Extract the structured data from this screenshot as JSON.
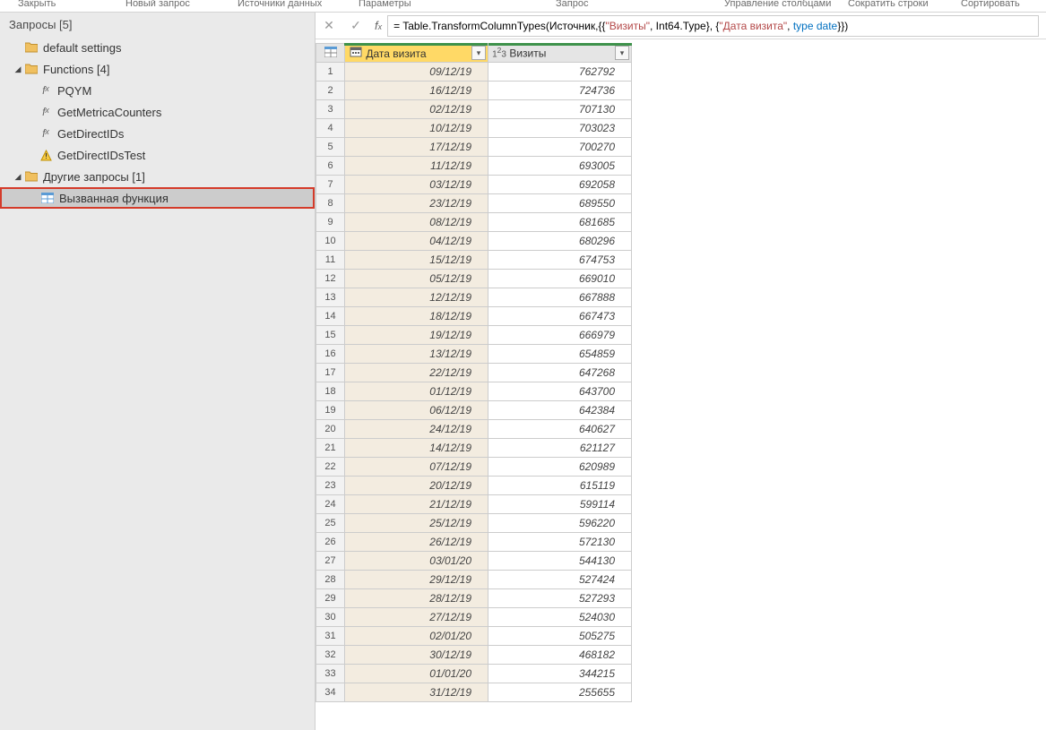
{
  "ribbon": {
    "close": "Закрыть",
    "new_query": "Новый запрос",
    "data_sources": "Источники данных",
    "parameters": "Параметры",
    "query": "Запрос",
    "manage_columns": "Управление столбцами",
    "reduce_rows": "Сократить строки",
    "sort": "Сортировать"
  },
  "sidebar": {
    "title": "Запросы [5]",
    "items": [
      {
        "label": "default settings",
        "icon": "folder",
        "level": 1
      },
      {
        "label": "Functions [4]",
        "icon": "folder",
        "level": 1,
        "expanded": true
      },
      {
        "label": "PQYM",
        "icon": "fx",
        "level": 2
      },
      {
        "label": "GetMetricaCounters",
        "icon": "fx",
        "level": 2
      },
      {
        "label": "GetDirectIDs",
        "icon": "fx",
        "level": 2
      },
      {
        "label": "GetDirectIDsTest",
        "icon": "warn",
        "level": 2
      },
      {
        "label": "Другие запросы [1]",
        "icon": "folder",
        "level": 1,
        "expanded": true
      },
      {
        "label": "Вызванная функция",
        "icon": "table",
        "level": 2,
        "selected": true
      }
    ]
  },
  "formula": {
    "prefix": "= Table.TransformColumnTypes(Источник,{{",
    "str1": "\"Визиты\"",
    "mid1": ", Int64.Type}, {",
    "str2": "\"Дата визита\"",
    "mid2": ", ",
    "type_kw": "type",
    "date_kw": " date",
    "suffix": "}})"
  },
  "columns": {
    "col1": "Дата визита",
    "col2": "Визиты"
  },
  "rows": [
    {
      "n": 1,
      "d": "09/12/19",
      "v": "762792"
    },
    {
      "n": 2,
      "d": "16/12/19",
      "v": "724736"
    },
    {
      "n": 3,
      "d": "02/12/19",
      "v": "707130"
    },
    {
      "n": 4,
      "d": "10/12/19",
      "v": "703023"
    },
    {
      "n": 5,
      "d": "17/12/19",
      "v": "700270"
    },
    {
      "n": 6,
      "d": "11/12/19",
      "v": "693005"
    },
    {
      "n": 7,
      "d": "03/12/19",
      "v": "692058"
    },
    {
      "n": 8,
      "d": "23/12/19",
      "v": "689550"
    },
    {
      "n": 9,
      "d": "08/12/19",
      "v": "681685"
    },
    {
      "n": 10,
      "d": "04/12/19",
      "v": "680296"
    },
    {
      "n": 11,
      "d": "15/12/19",
      "v": "674753"
    },
    {
      "n": 12,
      "d": "05/12/19",
      "v": "669010"
    },
    {
      "n": 13,
      "d": "12/12/19",
      "v": "667888"
    },
    {
      "n": 14,
      "d": "18/12/19",
      "v": "667473"
    },
    {
      "n": 15,
      "d": "19/12/19",
      "v": "666979"
    },
    {
      "n": 16,
      "d": "13/12/19",
      "v": "654859"
    },
    {
      "n": 17,
      "d": "22/12/19",
      "v": "647268"
    },
    {
      "n": 18,
      "d": "01/12/19",
      "v": "643700"
    },
    {
      "n": 19,
      "d": "06/12/19",
      "v": "642384"
    },
    {
      "n": 20,
      "d": "24/12/19",
      "v": "640627"
    },
    {
      "n": 21,
      "d": "14/12/19",
      "v": "621127"
    },
    {
      "n": 22,
      "d": "07/12/19",
      "v": "620989"
    },
    {
      "n": 23,
      "d": "20/12/19",
      "v": "615119"
    },
    {
      "n": 24,
      "d": "21/12/19",
      "v": "599114"
    },
    {
      "n": 25,
      "d": "25/12/19",
      "v": "596220"
    },
    {
      "n": 26,
      "d": "26/12/19",
      "v": "572130"
    },
    {
      "n": 27,
      "d": "03/01/20",
      "v": "544130"
    },
    {
      "n": 28,
      "d": "29/12/19",
      "v": "527424"
    },
    {
      "n": 29,
      "d": "28/12/19",
      "v": "527293"
    },
    {
      "n": 30,
      "d": "27/12/19",
      "v": "524030"
    },
    {
      "n": 31,
      "d": "02/01/20",
      "v": "505275"
    },
    {
      "n": 32,
      "d": "30/12/19",
      "v": "468182"
    },
    {
      "n": 33,
      "d": "01/01/20",
      "v": "344215"
    },
    {
      "n": 34,
      "d": "31/12/19",
      "v": "255655"
    }
  ]
}
